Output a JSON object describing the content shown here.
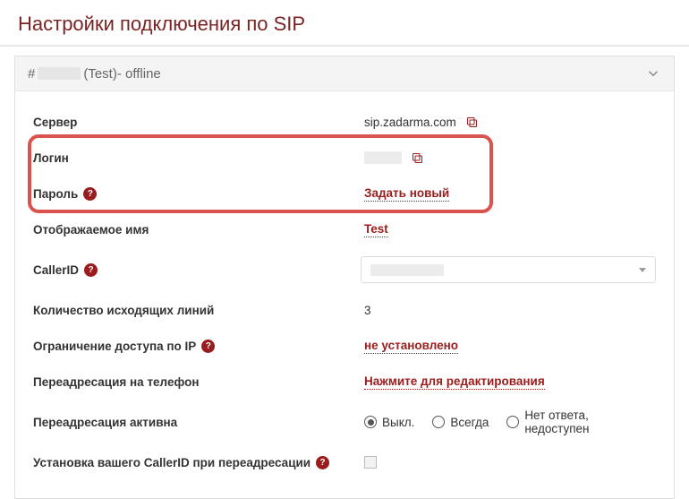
{
  "page": {
    "title": "Настройки подключения по SIP"
  },
  "panel": {
    "hash": "#",
    "test": " (Test)",
    "status": " - offline"
  },
  "rows": {
    "server": {
      "label": "Сервер",
      "value": "sip.zadarma.com"
    },
    "login": {
      "label": "Логин"
    },
    "password": {
      "label": "Пароль",
      "action": "Задать новый"
    },
    "displayname": {
      "label": "Отображаемое имя",
      "value": "Test"
    },
    "callerid": {
      "label": "CallerID"
    },
    "lines": {
      "label": "Количество исходящих линий",
      "value": "3"
    },
    "iplimit": {
      "label": "Ограничение доступа по IP",
      "value": "не установлено"
    },
    "forward_phone": {
      "label": "Переадресация на телефон",
      "value": "Нажмите для редактирования"
    },
    "forward_active": {
      "label": "Переадресация активна",
      "options": {
        "off": "Выкл.",
        "always": "Всегда",
        "noanswer": "Нет ответа, недоступен"
      }
    },
    "callerid_forward": {
      "label": "Установка вашего CallerID при переадресации"
    }
  }
}
